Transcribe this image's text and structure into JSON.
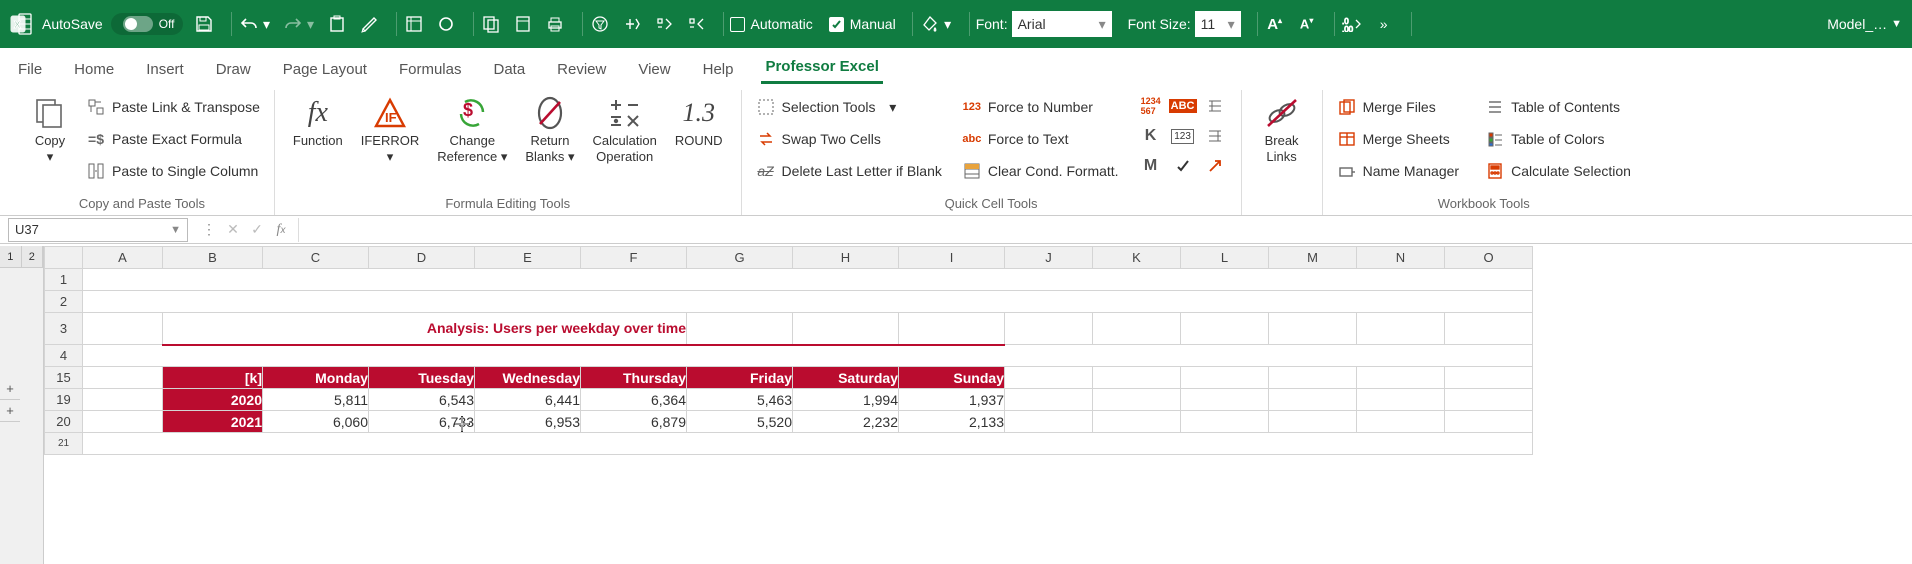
{
  "titlebar": {
    "autosave_label": "AutoSave",
    "autosave_state": "Off",
    "automatic_label": "Automatic",
    "manual_label": "Manual",
    "font_label": "Font:",
    "font_value": "Arial",
    "fontsize_label": "Font Size:",
    "fontsize_value": "11",
    "workbook_name": "Model_…"
  },
  "menutabs": [
    "File",
    "Home",
    "Insert",
    "Draw",
    "Page Layout",
    "Formulas",
    "Data",
    "Review",
    "View",
    "Help",
    "Professor Excel"
  ],
  "ribbon": {
    "groups": {
      "copy_paste": {
        "label": "Copy and Paste Tools",
        "copy": "Copy",
        "paste_link_transpose": "Paste Link & Transpose",
        "paste_exact": "Paste Exact Formula",
        "paste_single_col": "Paste to Single Column"
      },
      "formula_edit": {
        "label": "Formula Editing Tools",
        "function": "Function",
        "iferror": "IFERROR",
        "change_reference": "Change",
        "change_reference2": "Reference",
        "return_blanks": "Return",
        "return_blanks2": "Blanks",
        "calc_op": "Calculation",
        "calc_op2": "Operation",
        "round": "ROUND"
      },
      "quick_cell": {
        "label": "Quick Cell Tools",
        "selection_tools": "Selection Tools",
        "swap": "Swap Two Cells",
        "delete_last": "Delete Last Letter if Blank",
        "force_number": "Force to Number",
        "force_text": "Force to Text",
        "clear_cond": "Clear Cond. Formatt."
      },
      "break_links": {
        "label1": "Break",
        "label2": "Links"
      },
      "workbook": {
        "label": "Workbook Tools",
        "merge_files": "Merge Files",
        "merge_sheets": "Merge Sheets",
        "name_manager": "Name Manager",
        "toc": "Table of Contents",
        "tocolors": "Table of Colors",
        "calc_selection": "Calculate Selection"
      }
    }
  },
  "namebox": "U37",
  "sheet": {
    "columns": [
      "A",
      "B",
      "C",
      "D",
      "E",
      "F",
      "G",
      "H",
      "I",
      "J",
      "K",
      "L",
      "M",
      "N",
      "O"
    ],
    "visible_rows": [
      "1",
      "2",
      "3",
      "4",
      "15",
      "19",
      "20",
      "21"
    ],
    "title": "Analysis: Users per weekday over time",
    "corner_label": "[k]",
    "days": [
      "Monday",
      "Tuesday",
      "Wednesday",
      "Thursday",
      "Friday",
      "Saturday",
      "Sunday"
    ],
    "rows": [
      {
        "year": "2020",
        "values": [
          "5,811",
          "6,543",
          "6,441",
          "6,364",
          "5,463",
          "1,994",
          "1,937"
        ]
      },
      {
        "year": "2021",
        "values": [
          "6,060",
          "6,733",
          "6,953",
          "6,879",
          "5,520",
          "2,232",
          "2,133"
        ]
      }
    ],
    "outline_levels": [
      "1",
      "2"
    ],
    "outline_plus": "+"
  }
}
